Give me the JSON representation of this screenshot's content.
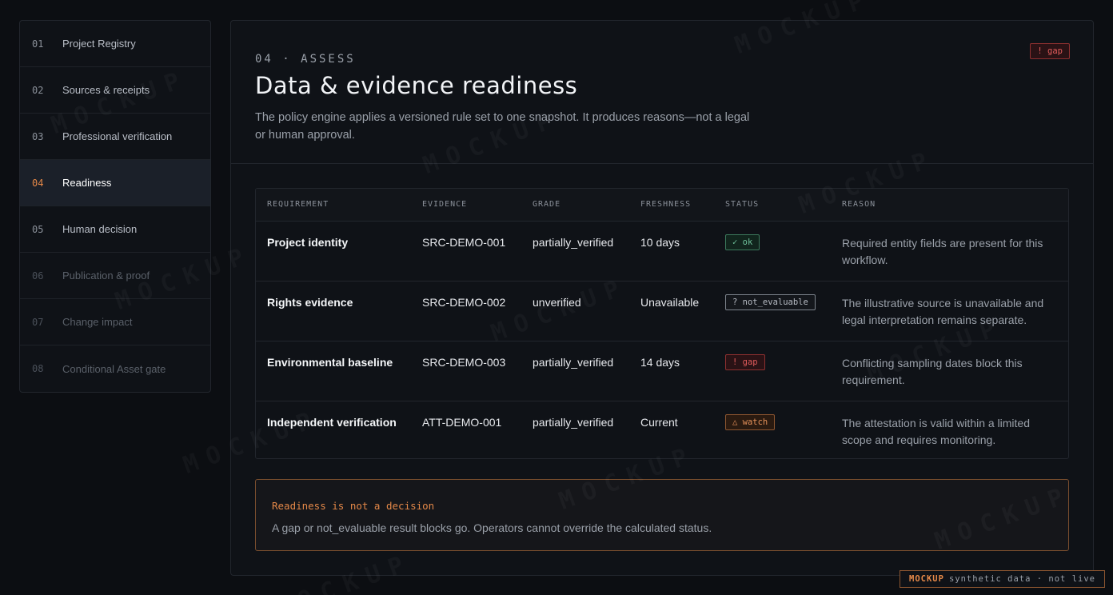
{
  "sidebar": {
    "items": [
      {
        "num": "01",
        "label": "Project Registry"
      },
      {
        "num": "02",
        "label": "Sources & receipts"
      },
      {
        "num": "03",
        "label": "Professional verification"
      },
      {
        "num": "04",
        "label": "Readiness"
      },
      {
        "num": "05",
        "label": "Human decision"
      },
      {
        "num": "06",
        "label": "Publication & proof"
      },
      {
        "num": "07",
        "label": "Change impact"
      },
      {
        "num": "08",
        "label": "Conditional Asset gate"
      }
    ]
  },
  "header": {
    "eyebrow": "04 · ASSESS",
    "title": "Data & evidence readiness",
    "description": "The policy engine applies a versioned rule set to one snapshot. It produces reasons—not a legal or human approval.",
    "badge": "! gap"
  },
  "table": {
    "columns": [
      "REQUIREMENT",
      "EVIDENCE",
      "GRADE",
      "FRESHNESS",
      "STATUS",
      "REASON"
    ],
    "rows": [
      {
        "requirement": "Project identity",
        "evidence": "SRC-DEMO-001",
        "grade": "partially_verified",
        "freshness": "10 days",
        "status": "✓ ok",
        "reason": "Required entity fields are present for this workflow."
      },
      {
        "requirement": "Rights evidence",
        "evidence": "SRC-DEMO-002",
        "grade": "unverified",
        "freshness": "Unavailable",
        "status": "? not_evaluable",
        "reason": "The illustrative source is unavailable and legal interpretation remains separate."
      },
      {
        "requirement": "Environmental baseline",
        "evidence": "SRC-DEMO-003",
        "grade": "partially_verified",
        "freshness": "14 days",
        "status": "! gap",
        "reason": "Conflicting sampling dates block this requirement."
      },
      {
        "requirement": "Independent verification",
        "evidence": "ATT-DEMO-001",
        "grade": "partially_verified",
        "freshness": "Current",
        "status": "△ watch",
        "reason": "The attestation is valid within a limited scope and requires monitoring."
      }
    ]
  },
  "callout": {
    "title": "Readiness is not a decision",
    "body": "A gap or not_evaluable result blocks go. Operators cannot override the calculated status."
  },
  "footer": {
    "strong": "MOCKUP",
    "text": "synthetic data · not live"
  },
  "watermark": "MOCKUP",
  "colors": {
    "accent": "#e48848",
    "ok": "#6fc19b",
    "gap": "#e05b5b",
    "watch": "#e3905a"
  }
}
